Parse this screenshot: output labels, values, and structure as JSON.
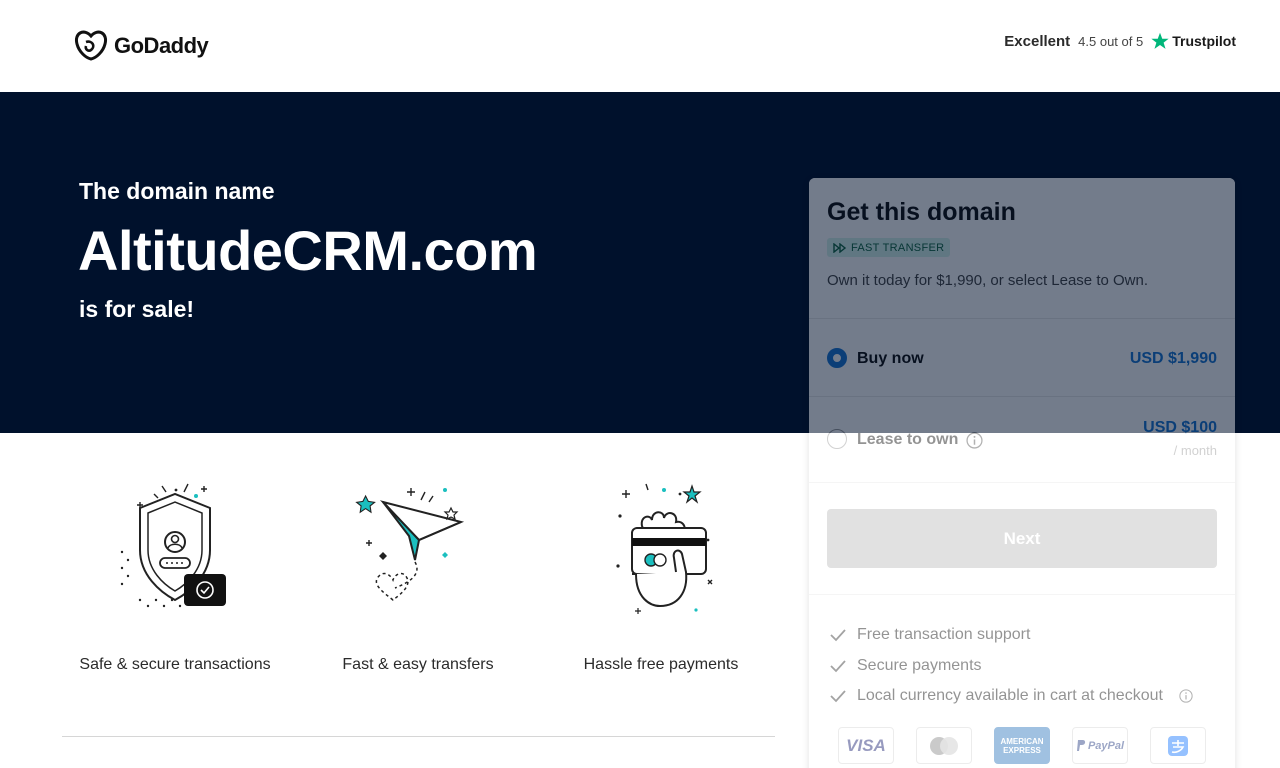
{
  "header": {
    "brand": "GoDaddy",
    "trust_excellent": "Excellent",
    "trust_rating": "4.5 out of 5",
    "trust_brand": "Trustpilot"
  },
  "hero": {
    "intro": "The domain name",
    "domain": "AltitudeCRM.com",
    "outro": "is for sale!"
  },
  "features": [
    {
      "label": "Safe & secure transactions",
      "icon": "shield-lock-icon"
    },
    {
      "label": "Fast & easy transfers",
      "icon": "paper-plane-icon"
    },
    {
      "label": "Hassle free payments",
      "icon": "card-payment-icon"
    }
  ],
  "card": {
    "title": "Get this domain",
    "badge": "FAST TRANSFER",
    "description": "Own it today for $1,990, or select Lease to Own.",
    "options": {
      "buy": {
        "label": "Buy now",
        "price": "USD $1,990",
        "selected": true
      },
      "lease": {
        "label": "Lease to own",
        "price": "USD $100",
        "sub": "/ month",
        "selected": false
      }
    },
    "next_label": "Next",
    "benefits": [
      "Free transaction support",
      "Secure payments",
      "Local currency available in cart at checkout"
    ],
    "payment_methods": [
      "VISA",
      "Mastercard",
      "AMERICAN EXPRESS",
      "PayPal",
      "Alipay"
    ]
  },
  "colors": {
    "hero_bg": "#00112c",
    "accent_blue": "#1976d2",
    "badge_bg": "#d6f3ea",
    "badge_text": "#116644",
    "teal_icon": "#1bbfbf",
    "button_disabled": "#bcbcbc"
  }
}
